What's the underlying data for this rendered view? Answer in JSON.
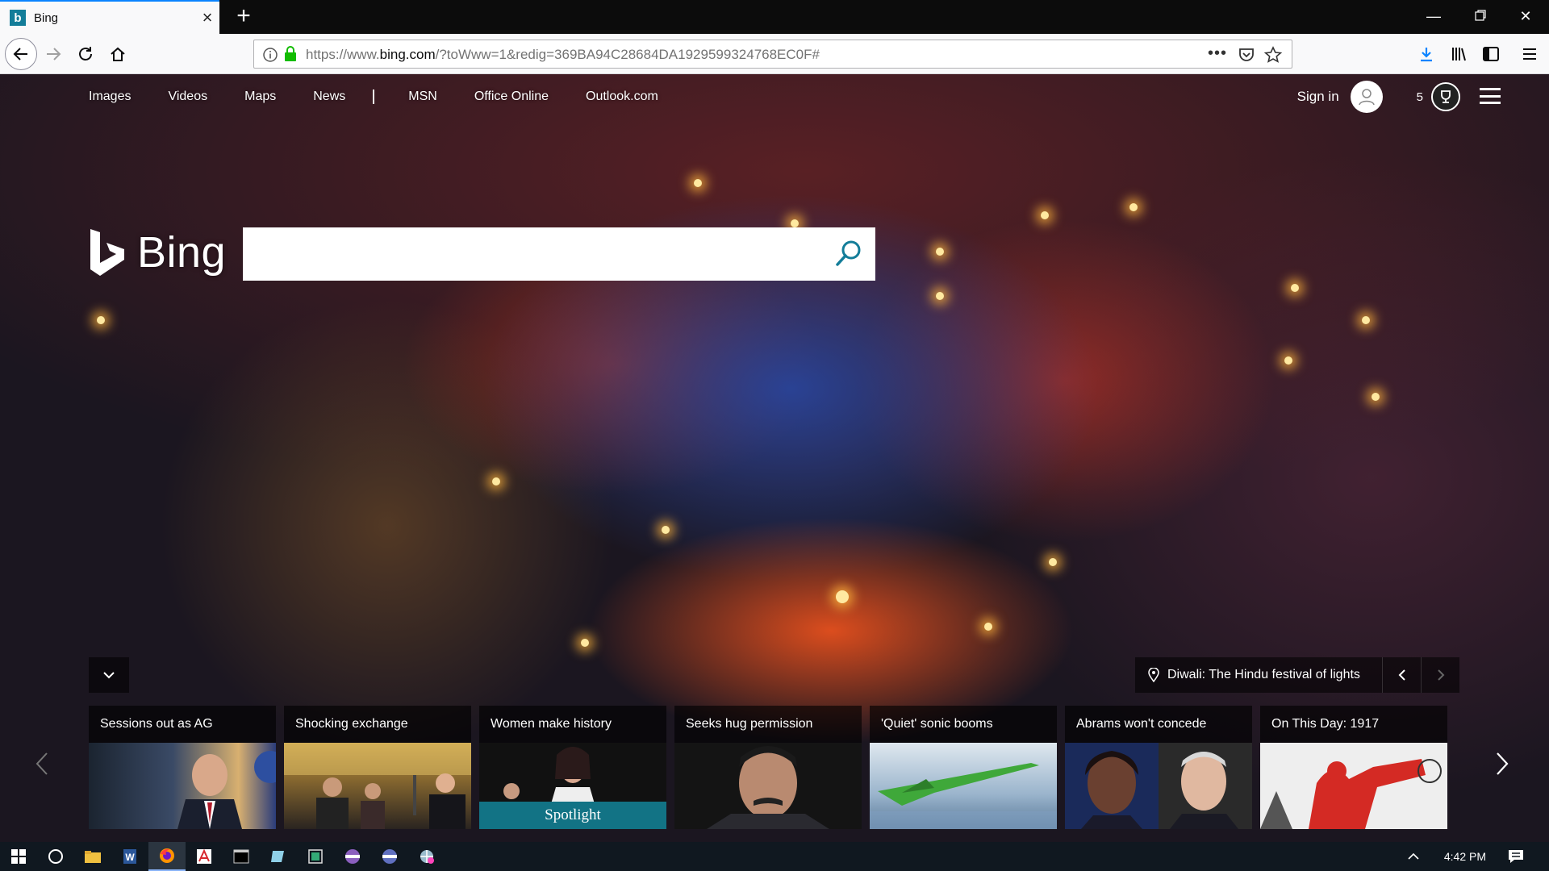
{
  "browser": {
    "tab_title": "Bing",
    "favicon_letter": "b",
    "url_prefix": "https://www.",
    "url_domain": "bing.com",
    "url_rest": "/?toWww=1&redig=369BA94C28684DA1929599324768EC0F#"
  },
  "nav": {
    "links": [
      "Images",
      "Videos",
      "Maps",
      "News",
      "MSN",
      "Office Online",
      "Outlook.com"
    ],
    "sign_in": "Sign in",
    "points": "5"
  },
  "logo_text": "Bing",
  "search": {
    "value": "",
    "placeholder": ""
  },
  "image_caption": "Diwali: The Hindu festival of lights",
  "news": [
    {
      "title": "Sessions out as AG"
    },
    {
      "title": "Shocking exchange"
    },
    {
      "title": "Women make history",
      "badge": "Spotlight"
    },
    {
      "title": "Seeks hug permission"
    },
    {
      "title": "'Quiet' sonic booms"
    },
    {
      "title": "Abrams won't concede"
    },
    {
      "title": "On This Day: 1917"
    }
  ],
  "taskbar": {
    "time": "4:42 PM"
  },
  "colors": {
    "accent": "#0a84ff",
    "spotlight": "#127385",
    "taskbar": "#101820"
  }
}
